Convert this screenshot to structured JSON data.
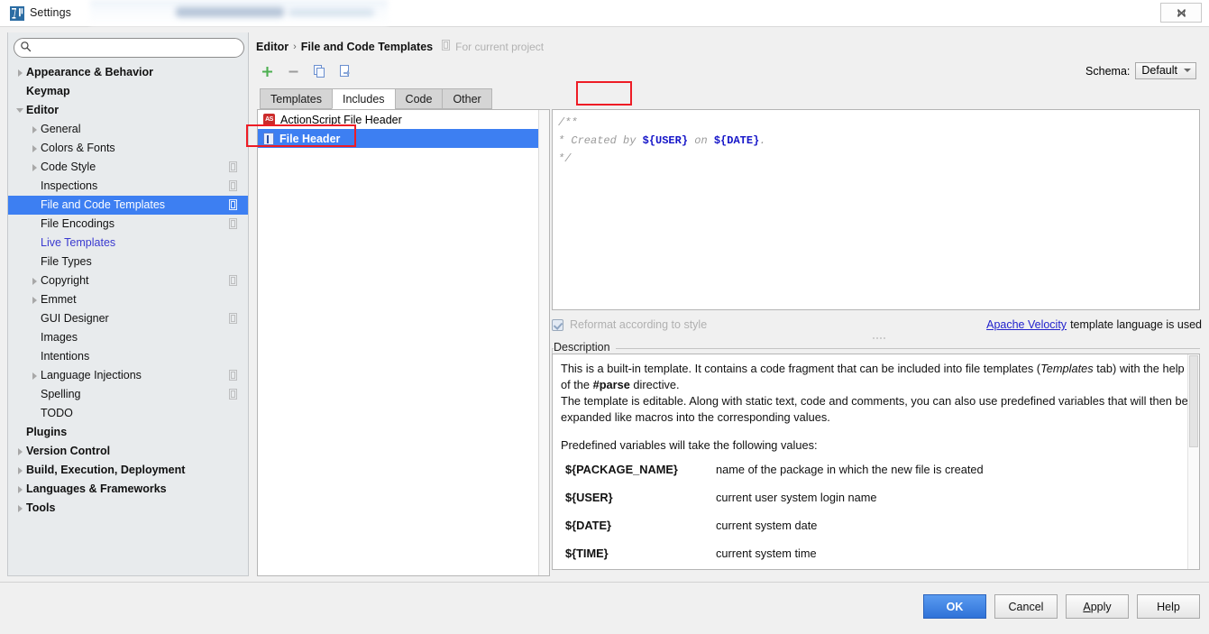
{
  "window": {
    "title": "Settings",
    "app_icon": "intellij-icon",
    "close_label": "✕"
  },
  "search": {
    "value": "",
    "placeholder": "",
    "icon": "search-icon"
  },
  "sidebar": {
    "items": [
      {
        "label": "Appearance & Behavior",
        "indent": 0,
        "arrow": "right",
        "bold": true,
        "link": false,
        "selected": false,
        "config_icon": false
      },
      {
        "label": "Keymap",
        "indent": 0,
        "arrow": "none",
        "bold": true,
        "link": false,
        "selected": false,
        "config_icon": false
      },
      {
        "label": "Editor",
        "indent": 0,
        "arrow": "down",
        "bold": true,
        "link": false,
        "selected": false,
        "config_icon": false
      },
      {
        "label": "General",
        "indent": 1,
        "arrow": "right",
        "bold": false,
        "link": false,
        "selected": false,
        "config_icon": false
      },
      {
        "label": "Colors & Fonts",
        "indent": 1,
        "arrow": "right",
        "bold": false,
        "link": false,
        "selected": false,
        "config_icon": false
      },
      {
        "label": "Code Style",
        "indent": 1,
        "arrow": "right",
        "bold": false,
        "link": false,
        "selected": false,
        "config_icon": true
      },
      {
        "label": "Inspections",
        "indent": 1,
        "arrow": "none",
        "bold": false,
        "link": false,
        "selected": false,
        "config_icon": true
      },
      {
        "label": "File and Code Templates",
        "indent": 1,
        "arrow": "none",
        "bold": false,
        "link": false,
        "selected": true,
        "config_icon": true
      },
      {
        "label": "File Encodings",
        "indent": 1,
        "arrow": "none",
        "bold": false,
        "link": false,
        "selected": false,
        "config_icon": true
      },
      {
        "label": "Live Templates",
        "indent": 1,
        "arrow": "none",
        "bold": false,
        "link": true,
        "selected": false,
        "config_icon": false
      },
      {
        "label": "File Types",
        "indent": 1,
        "arrow": "none",
        "bold": false,
        "link": false,
        "selected": false,
        "config_icon": false
      },
      {
        "label": "Copyright",
        "indent": 1,
        "arrow": "right",
        "bold": false,
        "link": false,
        "selected": false,
        "config_icon": true
      },
      {
        "label": "Emmet",
        "indent": 1,
        "arrow": "right",
        "bold": false,
        "link": false,
        "selected": false,
        "config_icon": false
      },
      {
        "label": "GUI Designer",
        "indent": 1,
        "arrow": "none",
        "bold": false,
        "link": false,
        "selected": false,
        "config_icon": true
      },
      {
        "label": "Images",
        "indent": 1,
        "arrow": "none",
        "bold": false,
        "link": false,
        "selected": false,
        "config_icon": false
      },
      {
        "label": "Intentions",
        "indent": 1,
        "arrow": "none",
        "bold": false,
        "link": false,
        "selected": false,
        "config_icon": false
      },
      {
        "label": "Language Injections",
        "indent": 1,
        "arrow": "right",
        "bold": false,
        "link": false,
        "selected": false,
        "config_icon": true
      },
      {
        "label": "Spelling",
        "indent": 1,
        "arrow": "none",
        "bold": false,
        "link": false,
        "selected": false,
        "config_icon": true
      },
      {
        "label": "TODO",
        "indent": 1,
        "arrow": "none",
        "bold": false,
        "link": false,
        "selected": false,
        "config_icon": false
      },
      {
        "label": "Plugins",
        "indent": 0,
        "arrow": "none",
        "bold": true,
        "link": false,
        "selected": false,
        "config_icon": false
      },
      {
        "label": "Version Control",
        "indent": 0,
        "arrow": "right",
        "bold": true,
        "link": false,
        "selected": false,
        "config_icon": false
      },
      {
        "label": "Build, Execution, Deployment",
        "indent": 0,
        "arrow": "right",
        "bold": true,
        "link": false,
        "selected": false,
        "config_icon": false
      },
      {
        "label": "Languages & Frameworks",
        "indent": 0,
        "arrow": "right",
        "bold": true,
        "link": false,
        "selected": false,
        "config_icon": false
      },
      {
        "label": "Tools",
        "indent": 0,
        "arrow": "right",
        "bold": true,
        "link": false,
        "selected": false,
        "config_icon": false
      }
    ]
  },
  "header": {
    "breadcrumb_parent": "Editor",
    "breadcrumb_separator": "›",
    "breadcrumb_current": "File and Code Templates",
    "scope_note": "For current project",
    "scope_icon": "project-scope-icon"
  },
  "toolbar": {
    "add_icon": "plus-icon",
    "remove_icon": "minus-icon",
    "copy_icon": "copy-icon",
    "reset_icon": "reset-icon"
  },
  "schema": {
    "label": "Schema:",
    "value": "Default"
  },
  "tabs": [
    {
      "label": "Templates",
      "active": false
    },
    {
      "label": "Includes",
      "active": true
    },
    {
      "label": "Code",
      "active": false
    },
    {
      "label": "Other",
      "active": false
    }
  ],
  "template_list": [
    {
      "label": "ActionScript File Header",
      "icon": "actionscript-file-icon",
      "icon_text": "AS",
      "selected": false
    },
    {
      "label": "File Header",
      "icon": "file-header-icon",
      "icon_text": "",
      "selected": true
    }
  ],
  "editor": {
    "line1": "/**",
    "line2_prefix": " * Created by ",
    "line2_var1": "${USER}",
    "line2_mid": " on ",
    "line2_var2": "${DATE}",
    "line2_suffix": ".",
    "line3": " */"
  },
  "options": {
    "reformat_label": "Reformat according to style",
    "reformat_checked": true,
    "velocity_link": "Apache Velocity",
    "velocity_suffix": "template language is used"
  },
  "description": {
    "legend": "Description",
    "para1_a": "This is a built-in template. It contains a code fragment that can be included into file templates (",
    "para1_em": "Templates",
    "para1_b": " tab) with the help of the ",
    "para1_strong": "#parse",
    "para1_c": " directive.",
    "para2": "The template is editable. Along with static text, code and comments, you can also use predefined variables that will then be expanded like macros into the corresponding values.",
    "para3": "Predefined variables will take the following values:",
    "variables": [
      {
        "name": "${PACKAGE_NAME}",
        "desc": "name of the package in which the new file is created"
      },
      {
        "name": "${USER}",
        "desc": "current user system login name"
      },
      {
        "name": "${DATE}",
        "desc": "current system date"
      },
      {
        "name": "${TIME}",
        "desc": "current system time"
      }
    ]
  },
  "buttons": {
    "ok": "OK",
    "cancel": "Cancel",
    "apply_prefix": "A",
    "apply_rest": "pply",
    "help": "Help"
  },
  "colors": {
    "selection_blue": "#3d7ff2",
    "annotation_red": "#ee1c25",
    "link_blue": "#2222cc",
    "code_var_blue": "#1414c8",
    "primary_button": "#2f72d8"
  }
}
